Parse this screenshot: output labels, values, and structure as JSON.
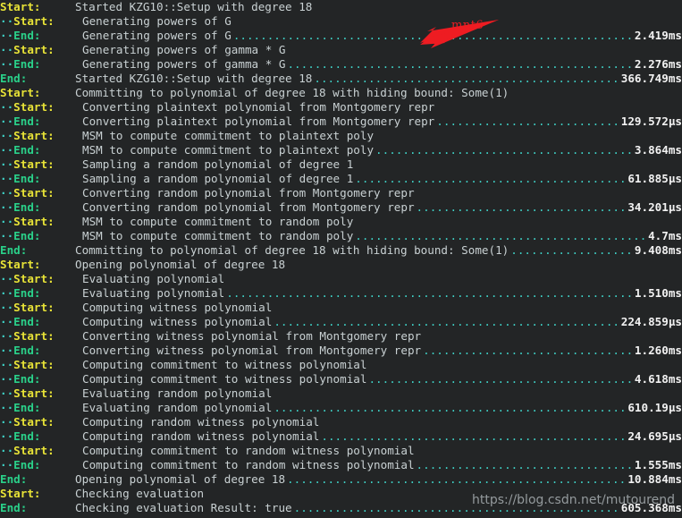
{
  "terminal": {
    "background": "#232526",
    "colors": {
      "start_label": "#e8e337",
      "end_label": "#2ad18a",
      "message": "#c9d1d3",
      "leader_dots": "#3fd2c7",
      "value": "#f2f2f2",
      "annotation": "#ee1c22",
      "watermark": "#9aa0a3"
    },
    "lines": [
      {
        "label": "Start:",
        "kind": "start",
        "depth": 0,
        "message": "Started KZG10::Setup with degree 18",
        "value": ""
      },
      {
        "label": "Start:",
        "kind": "start",
        "depth": 1,
        "message": "Generating powers of G",
        "value": ""
      },
      {
        "label": "End:",
        "kind": "end",
        "depth": 1,
        "message": "Generating powers of G",
        "value": "2.419ms"
      },
      {
        "label": "Start:",
        "kind": "start",
        "depth": 1,
        "message": "Generating powers of gamma * G",
        "value": ""
      },
      {
        "label": "End:",
        "kind": "end",
        "depth": 1,
        "message": "Generating powers of gamma * G",
        "value": "2.276ms"
      },
      {
        "label": "End:",
        "kind": "end",
        "depth": 0,
        "message": "Started KZG10::Setup with degree 18",
        "value": "366.749ms"
      },
      {
        "label": "Start:",
        "kind": "start",
        "depth": 0,
        "message": "Committing to polynomial of degree 18 with hiding bound: Some(1)",
        "value": ""
      },
      {
        "label": "Start:",
        "kind": "start",
        "depth": 1,
        "message": "Converting plaintext polynomial from Montgomery repr",
        "value": ""
      },
      {
        "label": "End:",
        "kind": "end",
        "depth": 1,
        "message": "Converting plaintext polynomial from Montgomery repr",
        "value": "129.572µs"
      },
      {
        "label": "Start:",
        "kind": "start",
        "depth": 1,
        "message": "MSM to compute commitment to plaintext poly",
        "value": ""
      },
      {
        "label": "End:",
        "kind": "end",
        "depth": 1,
        "message": "MSM to compute commitment to plaintext poly",
        "value": "3.864ms"
      },
      {
        "label": "Start:",
        "kind": "start",
        "depth": 1,
        "message": "Sampling a random polynomial of degree 1",
        "value": ""
      },
      {
        "label": "End:",
        "kind": "end",
        "depth": 1,
        "message": "Sampling a random polynomial of degree 1",
        "value": "61.885µs"
      },
      {
        "label": "Start:",
        "kind": "start",
        "depth": 1,
        "message": "Converting random polynomial from Montgomery repr",
        "value": ""
      },
      {
        "label": "End:",
        "kind": "end",
        "depth": 1,
        "message": "Converting random polynomial from Montgomery repr",
        "value": "34.201µs"
      },
      {
        "label": "Start:",
        "kind": "start",
        "depth": 1,
        "message": "MSM to compute commitment to random poly",
        "value": ""
      },
      {
        "label": "End:",
        "kind": "end",
        "depth": 1,
        "message": "MSM to compute commitment to random poly",
        "value": "4.7ms"
      },
      {
        "label": "End:",
        "kind": "end",
        "depth": 0,
        "message": "Committing to polynomial of degree 18 with hiding bound: Some(1)",
        "value": "9.408ms"
      },
      {
        "label": "Start:",
        "kind": "start",
        "depth": 0,
        "message": "Opening polynomial of degree 18",
        "value": ""
      },
      {
        "label": "Start:",
        "kind": "start",
        "depth": 1,
        "message": "Evaluating polynomial",
        "value": ""
      },
      {
        "label": "End:",
        "kind": "end",
        "depth": 1,
        "message": "Evaluating polynomial",
        "value": "1.510ms"
      },
      {
        "label": "Start:",
        "kind": "start",
        "depth": 1,
        "message": "Computing witness polynomial",
        "value": ""
      },
      {
        "label": "End:",
        "kind": "end",
        "depth": 1,
        "message": "Computing witness polynomial",
        "value": "224.859µs"
      },
      {
        "label": "Start:",
        "kind": "start",
        "depth": 1,
        "message": "Converting witness polynomial from Montgomery repr",
        "value": ""
      },
      {
        "label": "End:",
        "kind": "end",
        "depth": 1,
        "message": "Converting witness polynomial from Montgomery repr",
        "value": "1.260ms"
      },
      {
        "label": "Start:",
        "kind": "start",
        "depth": 1,
        "message": "Computing commitment to witness polynomial",
        "value": ""
      },
      {
        "label": "End:",
        "kind": "end",
        "depth": 1,
        "message": "Computing commitment to witness polynomial",
        "value": "4.618ms"
      },
      {
        "label": "Start:",
        "kind": "start",
        "depth": 1,
        "message": "Evaluating random polynomial",
        "value": ""
      },
      {
        "label": "End:",
        "kind": "end",
        "depth": 1,
        "message": "Evaluating random polynomial",
        "value": "610.19µs"
      },
      {
        "label": "Start:",
        "kind": "start",
        "depth": 1,
        "message": "Computing random witness polynomial",
        "value": ""
      },
      {
        "label": "End:",
        "kind": "end",
        "depth": 1,
        "message": "Computing random witness polynomial",
        "value": "24.695µs"
      },
      {
        "label": "Start:",
        "kind": "start",
        "depth": 1,
        "message": "Computing commitment to random witness polynomial",
        "value": ""
      },
      {
        "label": "End:",
        "kind": "end",
        "depth": 1,
        "message": "Computing commitment to random witness polynomial",
        "value": "1.555ms"
      },
      {
        "label": "End:",
        "kind": "end",
        "depth": 0,
        "message": "Opening polynomial of degree 18",
        "value": "10.884ms"
      },
      {
        "label": "Start:",
        "kind": "start",
        "depth": 0,
        "message": "Checking evaluation",
        "value": ""
      },
      {
        "label": "End:",
        "kind": "end",
        "depth": 0,
        "message": "Checking evaluation Result: true",
        "value": "605.368ms",
        "no_space_before_leader": true
      }
    ]
  },
  "annotation": {
    "label": "mnt6",
    "color": "#ee1c22"
  },
  "watermark": {
    "text": "https://blog.csdn.net/mutourend"
  }
}
